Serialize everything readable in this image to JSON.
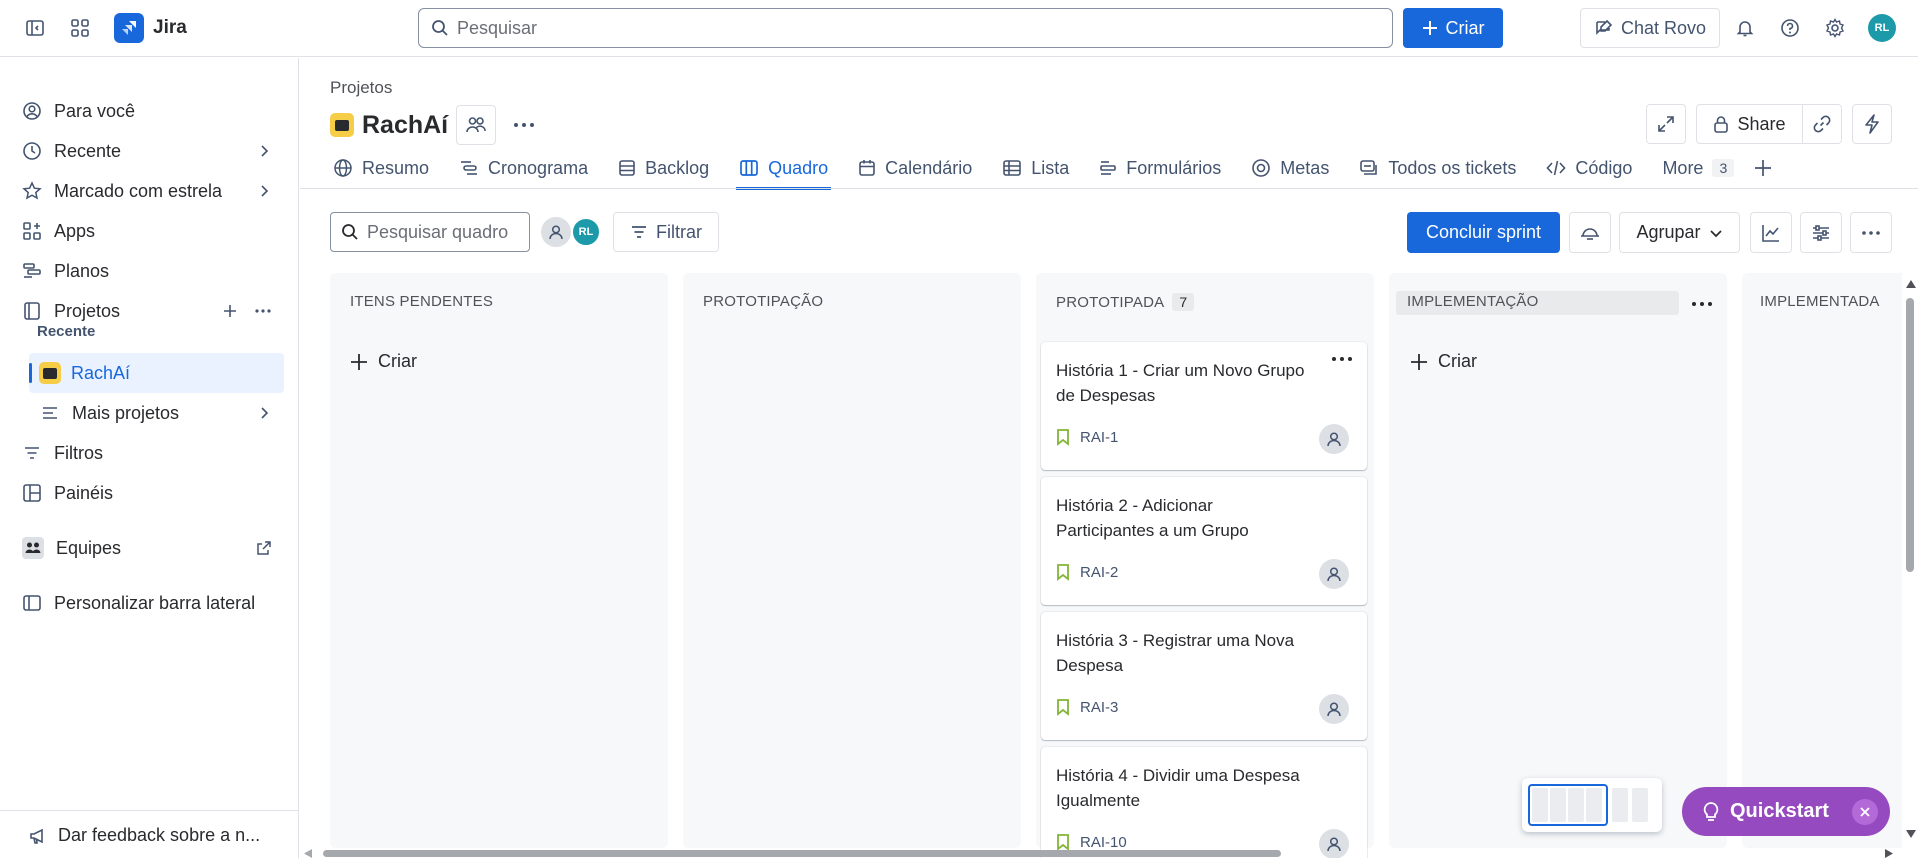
{
  "topbar": {
    "app_name": "Jira",
    "search_placeholder": "Pesquisar",
    "create_label": "Criar",
    "rovo_label": "Chat Rovo",
    "avatar_initials": "RL"
  },
  "sidebar": {
    "items": [
      {
        "label": "Para você",
        "icon": "user-circle-icon"
      },
      {
        "label": "Recente",
        "icon": "clock-icon"
      },
      {
        "label": "Marcado com estrela",
        "icon": "star-icon"
      },
      {
        "label": "Apps",
        "icon": "apps-icon"
      },
      {
        "label": "Planos",
        "icon": "plans-icon"
      },
      {
        "label": "Projetos",
        "icon": "projects-icon"
      }
    ],
    "recent_label": "Recente",
    "active_project": "RachAí",
    "more_projects": "Mais projetos",
    "filters": "Filtros",
    "dashboards": "Painéis",
    "teams": "Equipes",
    "customize": "Personalizar barra lateral",
    "feedback": "Dar feedback sobre a n..."
  },
  "header": {
    "breadcrumb": "Projetos",
    "project_name": "RachAí",
    "share_label": "Share"
  },
  "tabs": [
    {
      "label": "Resumo",
      "icon": "globe-icon"
    },
    {
      "label": "Cronograma",
      "icon": "timeline-icon"
    },
    {
      "label": "Backlog",
      "icon": "backlog-icon"
    },
    {
      "label": "Quadro",
      "icon": "board-icon",
      "active": true
    },
    {
      "label": "Calendário",
      "icon": "calendar-icon"
    },
    {
      "label": "Lista",
      "icon": "list-icon"
    },
    {
      "label": "Formulários",
      "icon": "forms-icon"
    },
    {
      "label": "Metas",
      "icon": "goals-icon"
    },
    {
      "label": "Todos os tickets",
      "icon": "tickets-icon"
    },
    {
      "label": "Código",
      "icon": "code-icon"
    }
  ],
  "more_tab": {
    "label": "More",
    "count": "3"
  },
  "toolbar": {
    "search_placeholder": "Pesquisar quadro",
    "avatar_initials": "RL",
    "filter_label": "Filtrar",
    "sprint_label": "Concluir sprint",
    "group_label": "Agrupar"
  },
  "columns": [
    {
      "title": "ITENS PENDENTES",
      "create_label": "Criar"
    },
    {
      "title": "PROTOTIPAÇÃO"
    },
    {
      "title": "PROTOTIPADA",
      "count": "7"
    },
    {
      "title": "IMPLEMENTAÇÃO",
      "create_label": "Criar"
    },
    {
      "title": "IMPLEMENTADA"
    }
  ],
  "cards": [
    {
      "title": "História 1 - Criar um Novo Grupo de Despesas",
      "key": "RAI-1"
    },
    {
      "title": "História 2 - Adicionar Participantes a um Grupo",
      "key": "RAI-2"
    },
    {
      "title": "História 3 - Registrar uma Nova Despesa",
      "key": "RAI-3"
    },
    {
      "title": "História 4 - Dividir uma Despesa Igualmente",
      "key": "RAI-10"
    }
  ],
  "quickstart": {
    "label": "Quickstart"
  },
  "colors": {
    "brand": "#1868db",
    "quickstart": "#964ac0",
    "story": "#82b536"
  }
}
